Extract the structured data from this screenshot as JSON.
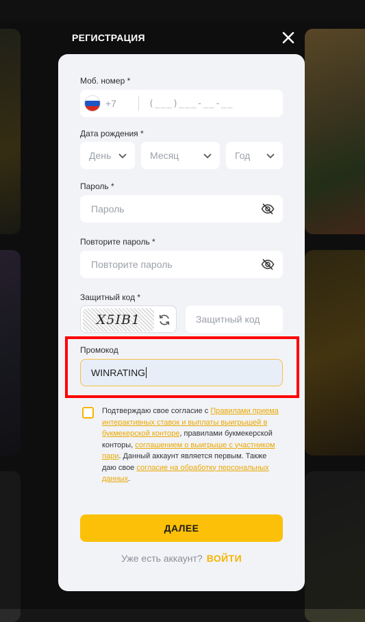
{
  "modal": {
    "title": "РЕГИСТРАЦИЯ",
    "close_icon": "close-icon"
  },
  "phone": {
    "label": "Моб. номер *",
    "country_flag": "russia-flag-icon",
    "country_code": "+7",
    "placeholder": "(___)___-__-__"
  },
  "birth": {
    "label": "Дата рождения *",
    "day": "День",
    "month": "Месяц",
    "year": "Год"
  },
  "password": {
    "label": "Пароль *",
    "placeholder": "Пароль",
    "toggle_icon": "eye-off-icon"
  },
  "repeat_password": {
    "label": "Повторите пароль *",
    "placeholder": "Повторите пароль",
    "toggle_icon": "eye-off-icon"
  },
  "captcha": {
    "label": "Защитный код *",
    "image_text": "X5IB1",
    "refresh_icon": "refresh-icon",
    "placeholder": "Защитный код"
  },
  "promo": {
    "label": "Промокод",
    "value": "WINRATING",
    "highlight_color": "#ff0000"
  },
  "consent": {
    "text1": "Подтверждаю свое согласие с ",
    "link1": "Правилами приема интерактивных ставок и выплаты выигрышей в букмекерской конторе",
    "text2": ", правилами букмекерской конторы, ",
    "link2": "соглашением о выигрыше с участником пари",
    "text3": ". Данный аккаунт является первым. Также даю свое ",
    "link3": "согласие на обработку персональных данных",
    "text4": "."
  },
  "submit_label": "ДАЛЕЕ",
  "login": {
    "prompt": "Уже есть аккаунт?",
    "link": "ВОЙТИ"
  },
  "colors": {
    "accent": "#fcc009",
    "link": "#e9a800",
    "modal_bg": "#f2f3f7"
  }
}
